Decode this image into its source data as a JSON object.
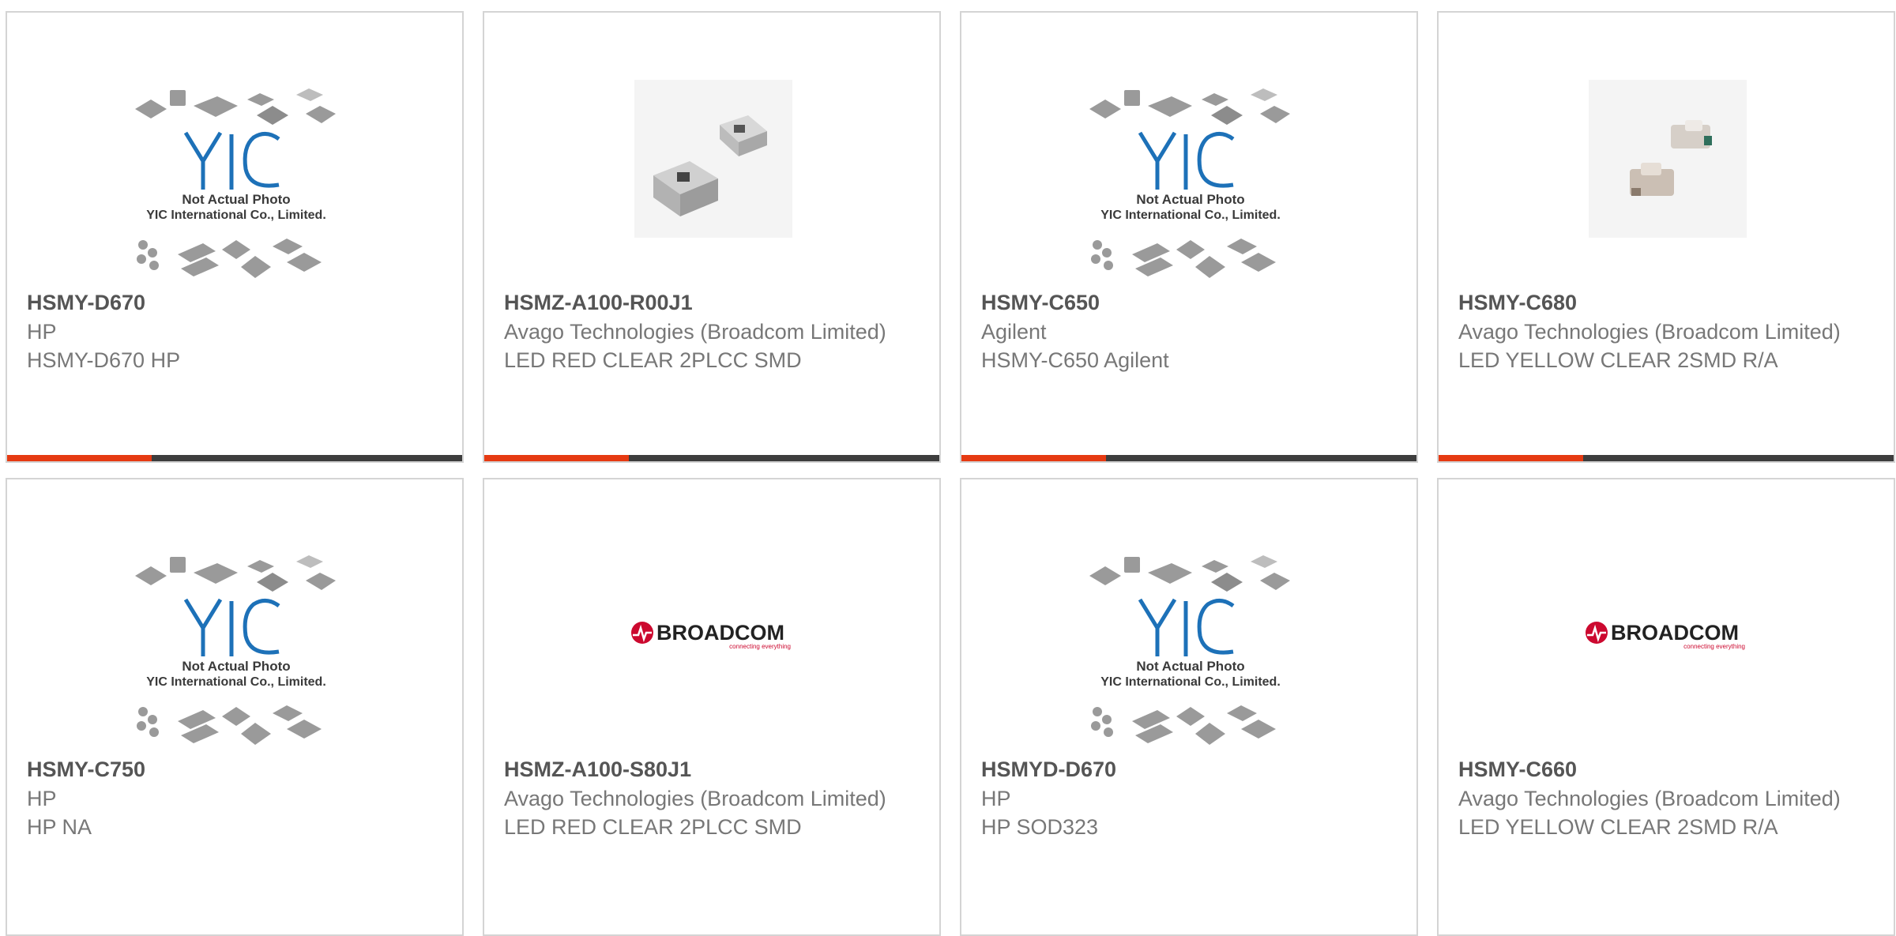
{
  "colors": {
    "accent": "#e63a12",
    "bar": "#3d3d3d",
    "yic_blue": "#1d71b8",
    "broadcom_red": "#cc092f"
  },
  "placeholder": {
    "line1": "Not Actual Photo",
    "line2": "YIC International Co., Limited.",
    "logo": "YIC"
  },
  "broadcom_logo": {
    "name": "BROADCOM",
    "tagline": "connecting everything"
  },
  "products": [
    {
      "part": "HSMY-D670",
      "manufacturer": "HP",
      "description": "HSMY-D670 HP",
      "image": "yic-placeholder"
    },
    {
      "part": "HSMZ-A100-R00J1",
      "manufacturer": "Avago Technologies (Broadcom Limited)",
      "description": "LED RED CLEAR 2PLCC SMD",
      "image": "led-photo-plcc"
    },
    {
      "part": "HSMY-C650",
      "manufacturer": "Agilent",
      "description": "HSMY-C650 Agilent",
      "image": "yic-placeholder"
    },
    {
      "part": "HSMY-C680",
      "manufacturer": "Avago Technologies (Broadcom Limited)",
      "description": "LED YELLOW CLEAR 2SMD R/A",
      "image": "led-photo-ra"
    },
    {
      "part": "HSMY-C750",
      "manufacturer": "HP",
      "description": "HP NA",
      "image": "yic-placeholder"
    },
    {
      "part": "HSMZ-A100-S80J1",
      "manufacturer": "Avago Technologies (Broadcom Limited)",
      "description": "LED RED CLEAR 2PLCC SMD",
      "image": "broadcom-logo"
    },
    {
      "part": "HSMYD-D670",
      "manufacturer": "HP",
      "description": "HP SOD323",
      "image": "yic-placeholder"
    },
    {
      "part": "HSMY-C660",
      "manufacturer": "Avago Technologies (Broadcom Limited)",
      "description": "LED YELLOW CLEAR 2SMD R/A",
      "image": "broadcom-logo"
    }
  ]
}
